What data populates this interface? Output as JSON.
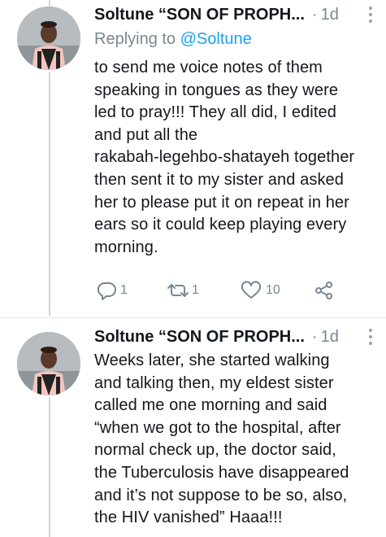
{
  "tweets": [
    {
      "author": "Soltune “SON OF PROPH...",
      "separator": "·",
      "time": "1d",
      "replying_prefix": "Replying to ",
      "replying_handle": "@Soltune",
      "lines": [
        "to send me voice notes of them",
        "speaking in tongues as they were",
        "led to pray!!! They all did, I edited",
        "and put all the",
        "rakabah-legehbo-shatayeh together",
        "then sent it to my sister and asked",
        "her to please put it on repeat in her",
        "ears so it could keep playing every",
        "morning."
      ],
      "actions": {
        "replies": "1",
        "retweets": "1",
        "likes": "10"
      }
    },
    {
      "author": "Soltune “SON OF PROPH...",
      "separator": "·",
      "time": "1d",
      "lines": [
        "Weeks later, she started walking",
        "and talking then, my eldest sister",
        "called me one morning and said",
        "“when we got to the hospital, after",
        "normal check up, the doctor said,",
        "the Tuberculosis have disappeared",
        "and it’s not suppose to be so, also,",
        "the HIV vanished” Haaa!!!"
      ]
    }
  ],
  "icons": {
    "more": "more-vertical-icon",
    "reply": "reply-icon",
    "retweet": "retweet-icon",
    "like": "heart-icon",
    "share": "share-icon"
  },
  "colors": {
    "link": "#1da1f2",
    "muted": "#7a8791",
    "text": "#14171a",
    "thread_line": "#cfd6db"
  }
}
